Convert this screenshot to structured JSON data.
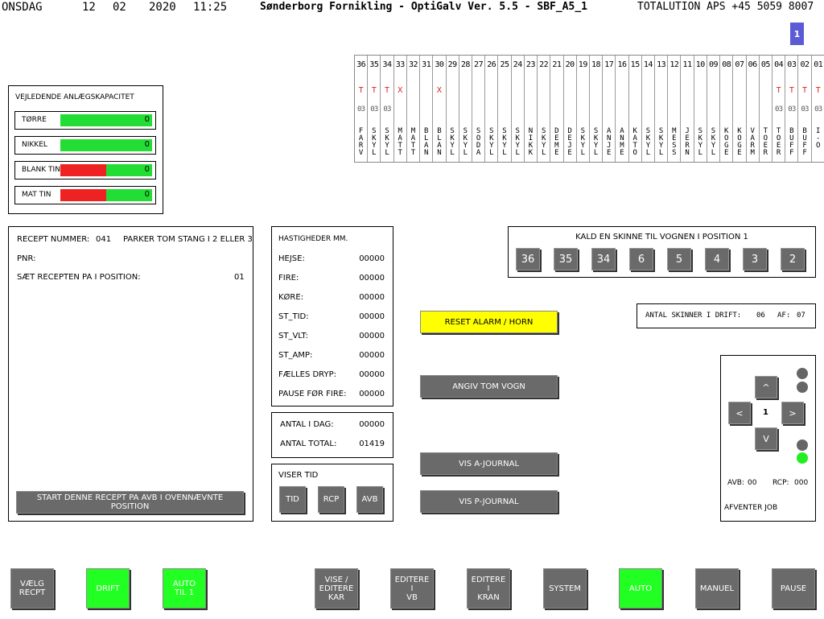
{
  "header": {
    "day": "ONSDAG",
    "date_day": "12",
    "date_month": "02",
    "date_year": "2020",
    "time": "11:25",
    "title": "Sønderborg Fornikling - OptiGalv Ver. 5.5 - SBF_A5_1",
    "company": "TOTALUTION APS +45 5059 8007",
    "page_badge": "1"
  },
  "rails": [
    {
      "num": "36",
      "mark": "T",
      "sub": "03",
      "label": "F\nA\nR\nV"
    },
    {
      "num": "35",
      "mark": "T",
      "sub": "03",
      "label": "S\nK\nY\nL"
    },
    {
      "num": "34",
      "mark": "T",
      "sub": "03",
      "label": "S\nK\nY\nL"
    },
    {
      "num": "33",
      "mark": "X",
      "sub": "",
      "label": "M\nA\nT\nT"
    },
    {
      "num": "32",
      "mark": "",
      "sub": "",
      "label": "M\nA\nT\nT"
    },
    {
      "num": "31",
      "mark": "",
      "sub": "",
      "label": "B\nL\nA\nN"
    },
    {
      "num": "30",
      "mark": "X",
      "sub": "",
      "label": "B\nL\nA\nN"
    },
    {
      "num": "29",
      "mark": "",
      "sub": "",
      "label": "S\nK\nY\nL"
    },
    {
      "num": "28",
      "mark": "",
      "sub": "",
      "label": "S\nK\nY\nL"
    },
    {
      "num": "27",
      "mark": "",
      "sub": "",
      "label": "S\nO\nD\nA"
    },
    {
      "num": "26",
      "mark": "",
      "sub": "",
      "label": "S\nK\nY\nL"
    },
    {
      "num": "25",
      "mark": "",
      "sub": "",
      "label": "S\nK\nY\nL"
    },
    {
      "num": "24",
      "mark": "",
      "sub": "",
      "label": "S\nK\nY\nL"
    },
    {
      "num": "23",
      "mark": "",
      "sub": "",
      "label": "N\nI\nK\nK"
    },
    {
      "num": "22",
      "mark": "",
      "sub": "",
      "label": "S\nK\nY\nL"
    },
    {
      "num": "21",
      "mark": "",
      "sub": "",
      "label": "D\nE\nM\nE"
    },
    {
      "num": "20",
      "mark": "",
      "sub": "",
      "label": "D\nE\nJ\nE"
    },
    {
      "num": "19",
      "mark": "",
      "sub": "",
      "label": "S\nK\nY\nL"
    },
    {
      "num": "18",
      "mark": "",
      "sub": "",
      "label": "S\nK\nY\nL"
    },
    {
      "num": "17",
      "mark": "",
      "sub": "",
      "label": "A\nN\nJ\nE"
    },
    {
      "num": "16",
      "mark": "",
      "sub": "",
      "label": "A\nN\nM\nE"
    },
    {
      "num": "15",
      "mark": "",
      "sub": "",
      "label": "K\nA\nT\nO"
    },
    {
      "num": "14",
      "mark": "",
      "sub": "",
      "label": "S\nK\nY\nL"
    },
    {
      "num": "13",
      "mark": "",
      "sub": "",
      "label": "S\nK\nY\nL"
    },
    {
      "num": "12",
      "mark": "",
      "sub": "",
      "label": "M\nE\nS\nS"
    },
    {
      "num": "11",
      "mark": "",
      "sub": "",
      "label": "J\nE\nR\nN"
    },
    {
      "num": "10",
      "mark": "",
      "sub": "",
      "label": "S\nK\nY\nL"
    },
    {
      "num": "09",
      "mark": "",
      "sub": "",
      "label": "S\nK\nY\nL"
    },
    {
      "num": "08",
      "mark": "",
      "sub": "",
      "label": "K\nO\nG\nE"
    },
    {
      "num": "07",
      "mark": "",
      "sub": "",
      "label": "K\nO\nG\nE"
    },
    {
      "num": "06",
      "mark": "",
      "sub": "",
      "label": "V\nA\nR\nM"
    },
    {
      "num": "05",
      "mark": "",
      "sub": "",
      "label": "T\nO\nE\nR"
    },
    {
      "num": "04",
      "mark": "T",
      "sub": "03",
      "label": "T\nO\nE\nR"
    },
    {
      "num": "03",
      "mark": "T",
      "sub": "03",
      "label": "B\nU\nF\nF"
    },
    {
      "num": "02",
      "mark": "T",
      "sub": "03",
      "label": "B\nU\nF\nF"
    },
    {
      "num": "01",
      "mark": "T",
      "sub": "03",
      "label": "I\n-\nO"
    }
  ],
  "capacity": {
    "title": "VEJLEDENDE ANLÆGSKAPACITET",
    "rows": [
      {
        "label": "TØRRE",
        "value": "0",
        "red_fraction": 0.0
      },
      {
        "label": "NIKKEL",
        "value": "0",
        "red_fraction": 0.0
      },
      {
        "label": "BLANK TIN",
        "value": "0",
        "red_fraction": 0.5
      },
      {
        "label": "MAT TIN",
        "value": "0",
        "red_fraction": 0.5
      }
    ]
  },
  "recipe": {
    "number_label": "RECEPT NUMMER:",
    "number_value": "041",
    "park_text": "PARKER TOM STANG I 2 ELLER 3",
    "pnr_label": "PNR:",
    "position_label": "SÆT RECEPTEN PA I POSITION:",
    "position_value": "01",
    "start_button": "START DENNE RECEPT PA AVB I OVENNÆVNTE POSITION"
  },
  "speeds": {
    "title": "HASTIGHEDER MM.",
    "rows": [
      {
        "label": "HEJSE:",
        "value": "00000"
      },
      {
        "label": "FIRE:",
        "value": "00000"
      },
      {
        "label": "KØRE:",
        "value": "00000"
      },
      {
        "label": "ST_TID:",
        "value": "00000"
      },
      {
        "label": "ST_VLT:",
        "value": "00000"
      },
      {
        "label": "ST_AMP:",
        "value": "00000"
      },
      {
        "label": "FÆLLES DRYP:",
        "value": "00000"
      },
      {
        "label": "PAUSE FØR FIRE:",
        "value": "00000"
      }
    ]
  },
  "counts": {
    "today_label": "ANTAL I DAG:",
    "today_value": "00000",
    "total_label": "ANTAL TOTAL:",
    "total_value": "01419"
  },
  "show_time": {
    "title": "VISER TID",
    "buttons": [
      "TID",
      "RCP",
      "AVB"
    ]
  },
  "call_rail": {
    "title": "KALD EN SKINNE TIL VOGNEN I POSITION 1",
    "buttons": [
      "36",
      "35",
      "34",
      "6",
      "5",
      "4",
      "3",
      "2"
    ]
  },
  "actions": {
    "reset": "RESET ALARM / HORN",
    "empty_cart": "ANGIV TOM VOGN",
    "a_journal": "VIS A-JOURNAL",
    "p_journal": "VIS P-JOURNAL"
  },
  "rails_in_operation": {
    "label": "ANTAL SKINNER I DRIFT:",
    "count": "06",
    "of_label": "AF:",
    "of_value": "07"
  },
  "nav": {
    "up": "^",
    "left": "<",
    "center": "1",
    "right": ">",
    "down": "V",
    "avb_label": "AVB:",
    "avb_value": "00",
    "rcp_label": "RCP:",
    "rcp_value": "000",
    "status": "AFVENTER JOB",
    "led_on_color": "#22ee22",
    "led_off_color": "#666666"
  },
  "bottom": {
    "choose_recipe": "VÆLG\nRECPT",
    "drift": "DRIFT",
    "auto_til": "AUTO\nTIL 1",
    "edit_kar": "VISE /\nEDITERE\nKAR",
    "edit_vb": "EDITERE\nI\nVB",
    "edit_kran": "EDITERE\nI\nKRAN",
    "system": "SYSTEM",
    "auto": "AUTO",
    "manual": "MANUEL",
    "pause": "PAUSE"
  },
  "colors": {
    "green": "#22ff22",
    "red": "#ee2222",
    "yellow": "#ffff00",
    "grey_button": "#6a6a6a",
    "badge": "#5b5bd6"
  }
}
